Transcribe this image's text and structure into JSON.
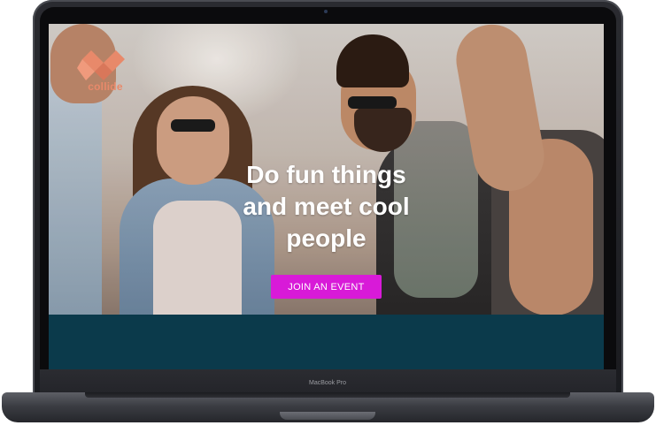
{
  "device": {
    "model_label": "MacBook Pro"
  },
  "site": {
    "logo_text": "collide",
    "headline_line1": "Do fun things",
    "headline_line2": "and meet cool",
    "headline_line3": "people",
    "cta_label": "JOIN AN EVENT"
  },
  "colors": {
    "accent": "#d81ad8",
    "logo": "#e8896a",
    "footer_band": "#0b3a4b"
  }
}
